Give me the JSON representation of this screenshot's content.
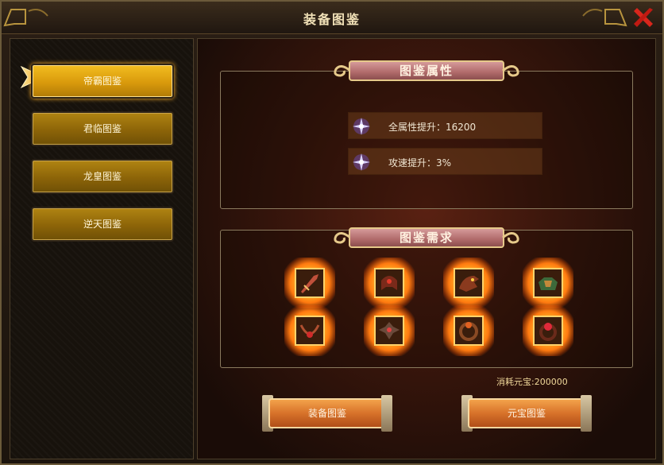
{
  "window": {
    "title": "装备图鉴"
  },
  "sidebar": {
    "items": [
      {
        "label": "帝霸图鉴",
        "active": true
      },
      {
        "label": "君临图鉴",
        "active": false
      },
      {
        "label": "龙皇图鉴",
        "active": false
      },
      {
        "label": "逆天图鉴",
        "active": false
      }
    ]
  },
  "attributes": {
    "header": "图鉴属性",
    "rows": [
      {
        "label": "全属性提升：16200",
        "icon": "purple-star-icon"
      },
      {
        "label": "攻速提升：3%",
        "icon": "purple-star-icon"
      }
    ]
  },
  "requirements": {
    "header": "图鉴需求",
    "items": [
      {
        "icon": "weapon-icon"
      },
      {
        "icon": "helmet-icon"
      },
      {
        "icon": "dragon-helmet-icon"
      },
      {
        "icon": "armor-icon"
      },
      {
        "icon": "necklace-icon"
      },
      {
        "icon": "bracelet-icon"
      },
      {
        "icon": "ring-icon"
      },
      {
        "icon": "gem-ring-icon"
      }
    ],
    "cost_label": "消耗元宝:200000"
  },
  "actions": {
    "equip_button": "装备图鉴",
    "gold_button": "元宝图鉴"
  },
  "colors": {
    "active_button": "#e6a812",
    "inactive_button": "#9a700c",
    "glow": "#ff9a1a",
    "banner": "#b06a6a"
  }
}
